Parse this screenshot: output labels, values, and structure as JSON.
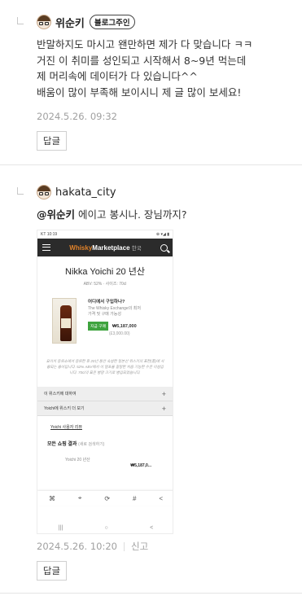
{
  "comments": [
    {
      "author": "위순키",
      "badge": "블로그주인",
      "lines": [
        "반말하지도 마시고 왠만하면 제가 다 맞습니다 ㅋㅋ",
        "거진 이 취미를 성인되고 시작해서 8~9년 먹는데",
        "제 머리속에 데이터가 다 있습니다^^",
        "배움이 많이 부족해 보이시니 제 글 많이 보세요!"
      ],
      "date": "2024.5.26. 09:32",
      "reply_label": "답글"
    },
    {
      "author": "hakata_city",
      "mention": "@위순키",
      "text": " 에이고 봉시나. 장님까지?",
      "date": "2024.5.26. 10:20",
      "report_label": "신고",
      "reply_label": "답글"
    }
  ],
  "phone": {
    "status_left": "KT 10:19",
    "status_right": "⊕ ▾◢ ▮",
    "brand_whisky": "Whisky",
    "brand_market": "Marketplace",
    "brand_locale": "한국",
    "product_title": "Nikka Yoichi 20 년산",
    "product_sub": "ABV: 52% · 사이즈: 70cl",
    "where_buy": "어디에서 구입하나?",
    "where_desc": "The Whisky Exchange의 최저 가격 및 구매 가능성",
    "buy_now": "지금 구매",
    "price_krw": "₩5,187,000",
    "price_gbp": "(£3,000.00)",
    "description": "요이치 증류소에서 증류한 후 20년 동안 숙성한 일본산 위스키의 표현(풍)에 사용되는 용어입니다. 52% ABV에서 이 얼프을 찰랑한 처음 기능한 수준 이성입니다. 70cl의 표준 병량 크기로 병입되었습니다.",
    "acc_about": "이 위스키에 대하여",
    "acc_more": "Yoichi에 위스키 더 보기",
    "acc_plus": "+",
    "yoichi_link": "Yoichi 사용자 리뷰",
    "results": "모든 쇼핑 결과",
    "results_sub": "(새로 검색하기)",
    "item_name": "Yoichi 20 년산",
    "item_price": "₩5,187,0...",
    "overlay_icons": [
      "⌘",
      "⌖",
      "⟳",
      "#",
      "<"
    ],
    "nav_icons": [
      "|||",
      "○",
      "<"
    ]
  }
}
